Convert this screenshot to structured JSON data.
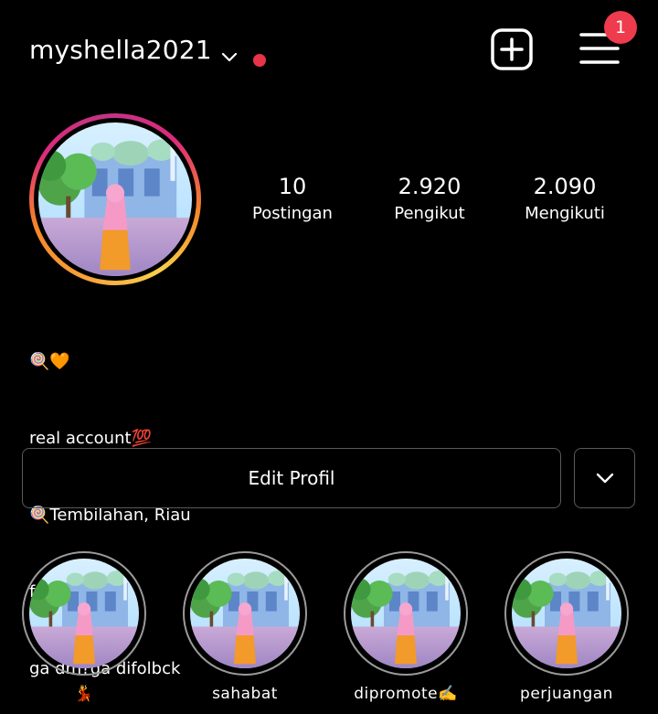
{
  "header": {
    "username": "myshella2021",
    "notification_count": "1",
    "icons": {
      "dropdown": "chevron-down-icon",
      "status": "red-dot",
      "create": "plus-square-icon",
      "menu": "hamburger-menu-icon"
    },
    "colors": {
      "status_dot": "#e8344a",
      "badge": "#ee3b4d"
    }
  },
  "profile": {
    "avatar": "profile-photo",
    "story_ring_colors": [
      "#f9d04a",
      "#f58529",
      "#dd2a7b",
      "#c13584"
    ],
    "stats": [
      {
        "value": "10",
        "label": "Postingan"
      },
      {
        "value": "2.920",
        "label": "Pengikut"
      },
      {
        "value": "2.090",
        "label": "Mengikuti"
      }
    ],
    "bio": [
      "🍭🧡",
      "real account💯",
      "🍭Tembilahan, Riau",
      "follbck dm!!",
      "ga dm?ga difolbck"
    ]
  },
  "actions": {
    "edit_profile_label": "Edit Profil",
    "dropdown_icon": "chevron-down-icon"
  },
  "highlights": [
    {
      "label": "💃"
    },
    {
      "label": "sahabat"
    },
    {
      "label": "dipromote✍️"
    },
    {
      "label": "perjuangan"
    }
  ]
}
